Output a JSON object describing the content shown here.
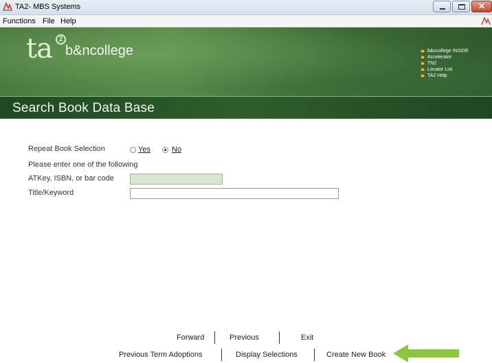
{
  "window": {
    "title": "TA2- MBS Systems",
    "icon": "mbs-app-icon"
  },
  "menu": {
    "items": [
      "Functions",
      "File",
      "Help"
    ]
  },
  "banner": {
    "logo_ta": "ta",
    "logo_two": "2",
    "logo_brand": "b&ncollege",
    "quick_links": [
      "b&ncollege INSIDE",
      "Accelerator",
      "TN2",
      "Locator List",
      "TA2 Help"
    ]
  },
  "page": {
    "title": "Search Book Data Base"
  },
  "form": {
    "repeat_label": "Repeat Book Selection",
    "repeat_yes": "Yes",
    "repeat_no": "No",
    "repeat_selected": "No",
    "instruction": "Please enter one of the following",
    "atkey_label": "ATKey, ISBN, or bar code",
    "atkey_value": "",
    "title_label": "Title/Keyword",
    "title_value": ""
  },
  "commands": {
    "row1": [
      "Forward",
      "Previous",
      "Exit"
    ],
    "row2": [
      "Previous Term Adoptions",
      "Display Selections",
      "Create New Book"
    ]
  },
  "colors": {
    "banner_green": "#4a7a3e",
    "title_bar_green": "#2f5d2c",
    "active_input": "#d8e6cf",
    "arrow": "#8cc63f"
  }
}
